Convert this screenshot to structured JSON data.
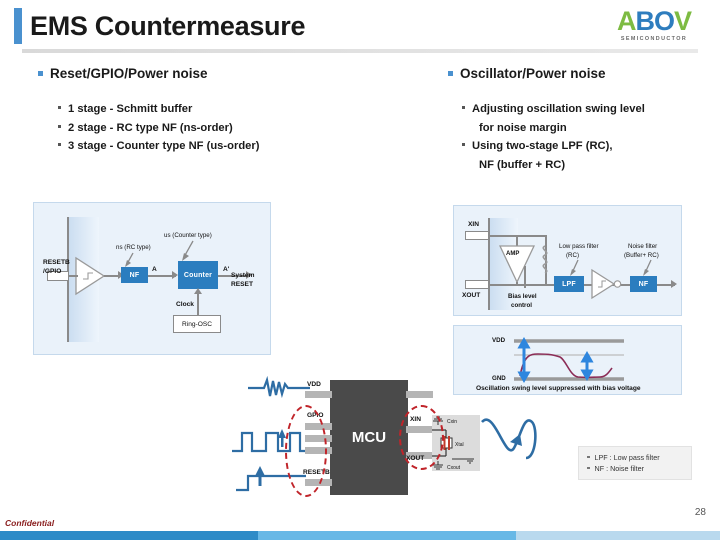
{
  "header": {
    "title": "EMS Countermeasure",
    "logo": {
      "part_a": "A",
      "part_bo": "BO",
      "part_v": "V",
      "subtitle": "SEMICONDUCTOR"
    },
    "accent_color": "#4A91CF"
  },
  "columns": {
    "left": {
      "heading": "Reset/GPIO/Power noise",
      "items": [
        "1 stage -  Schmitt buffer",
        "2 stage  - RC type NF (ns-order)",
        "3 stage  - Counter type NF (us-order)"
      ]
    },
    "right": {
      "heading": "Oscillator/Power noise",
      "items": [
        {
          "line1": "Adjusting oscillation swing level",
          "line2": "for noise margin"
        },
        {
          "line1": "Using two-stage LPF (RC),",
          "line2": "NF (buffer + RC)"
        }
      ]
    }
  },
  "diagram_reset": {
    "input_label_line1": "RESETB",
    "input_label_line2": "/GPIO",
    "callout_nf": "ns (RC type)",
    "callout_counter": "us (Counter type)",
    "block_nf": "NF",
    "block_counter": "Counter",
    "signal_a": "A",
    "signal_a_prime": "A'",
    "output_line1": "System",
    "output_line2": "RESET",
    "clock_label": "Clock",
    "ring_osc": "Ring-OSC"
  },
  "diagram_osc": {
    "pin_xin": "XIN",
    "pin_xout": "XOUT",
    "block_amp": "AMP",
    "block_lpf": "LPF",
    "block_nf": "NF",
    "callout_lpf_line1": "Low pass filter",
    "callout_lpf_line2": "(RC)",
    "callout_nf_line1": "Noise  filter",
    "callout_nf_line2": "(Buffer+ RC)",
    "bias_line1": "Bias level",
    "bias_line2": "control"
  },
  "diagram_swing": {
    "vdd": "VDD",
    "gnd": "GND",
    "caption": "Oscillation swing level suppressed with bias voltage"
  },
  "diagram_mcu": {
    "chip_label": "MCU",
    "pin_vdd": "VDD",
    "pin_gpio": "GPIO",
    "pin_resetb": "RESETB",
    "pin_xin": "XIN",
    "pin_xout": "XOUT",
    "cap_xin": "Cxin",
    "xtal": "Xtal",
    "cap_xout": "Cxout"
  },
  "legend": {
    "rows": [
      "LPF :  Low pass filter",
      "NF  :  Noise filter"
    ]
  },
  "footer": {
    "confidential": "Confidential",
    "page_number": "28",
    "bar_colors": [
      "#2E8BC7",
      "#68B8E6",
      "#B9D9EE"
    ]
  }
}
